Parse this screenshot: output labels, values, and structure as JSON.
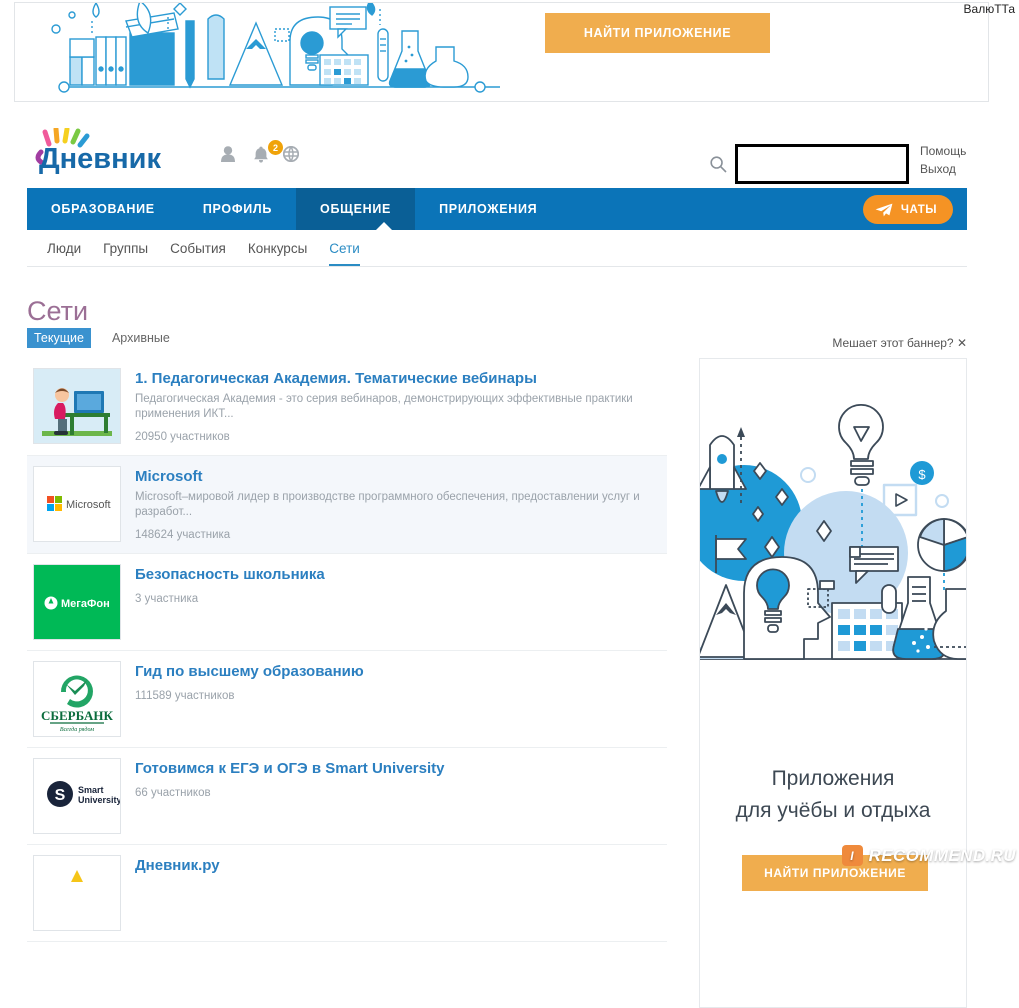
{
  "watermark_top": "ВалюТТа",
  "top_banner": {
    "cta_label": "НАЙТИ ПРИЛОЖЕНИЕ",
    "art_name": "education-illustration"
  },
  "header": {
    "logo_text": "Дневник",
    "icons": [
      {
        "name": "profile-icon",
        "label": "profile"
      },
      {
        "name": "bell-icon",
        "label": "notifications"
      },
      {
        "name": "globe-icon",
        "label": "language"
      }
    ],
    "notification_count": "2",
    "search": {
      "value": "",
      "placeholder": ""
    },
    "help_label": "Помощь",
    "logout_label": "Выход"
  },
  "nav": {
    "items": [
      {
        "label": "ОБРАЗОВАНИЕ",
        "active": false
      },
      {
        "label": "ПРОФИЛЬ",
        "active": false
      },
      {
        "label": "ОБЩЕНИЕ",
        "active": true
      },
      {
        "label": "ПРИЛОЖЕНИЯ",
        "active": false
      }
    ],
    "chat_label": "ЧАТЫ"
  },
  "subnav": {
    "items": [
      {
        "label": "Люди",
        "active": false
      },
      {
        "label": "Группы",
        "active": false
      },
      {
        "label": "События",
        "active": false
      },
      {
        "label": "Конкурсы",
        "active": false
      },
      {
        "label": "Сети",
        "active": true
      }
    ]
  },
  "page": {
    "title": "Сети",
    "filters": [
      {
        "label": "Текущие",
        "active": true
      },
      {
        "label": "Архивные",
        "active": false
      }
    ]
  },
  "networks": [
    {
      "title": "1. Педагогическая Академия. Тематические вебинары",
      "description": "Педагогическая Академия - это серия вебинаров, демонстрирующих эффективные практики применения ИКТ...",
      "members": "20950 участников",
      "logo_name": "pedagog-academy-logo",
      "highlighted": false
    },
    {
      "title": "Microsoft",
      "description": "Microsoft–мировой лидер в производстве программного обеспечения, предоставлении услуг и разработ...",
      "members": "148624 участника",
      "logo_name": "microsoft-logo",
      "highlighted": true
    },
    {
      "title": "Безопасность школьника",
      "description": "",
      "members": "3 участника",
      "logo_name": "megafon-logo",
      "highlighted": false
    },
    {
      "title": "Гид по высшему образованию",
      "description": "",
      "members": "111589 участников",
      "logo_name": "sberbank-logo",
      "highlighted": false
    },
    {
      "title": "Готовимся к ЕГЭ и ОГЭ в Smart University",
      "description": "",
      "members": "66 участников",
      "logo_name": "smart-university-logo",
      "highlighted": false
    },
    {
      "title": "Дневник.ру",
      "description": "",
      "members": "",
      "logo_name": "dnevnik-ru-logo",
      "highlighted": false
    }
  ],
  "side_banner": {
    "dismiss_label": "Мешает этот баннер?",
    "headline_line1": "Приложения",
    "headline_line2": "для учёбы и отдыха",
    "cta_label": "НАЙТИ ПРИЛОЖЕНИЕ",
    "art_name": "apps-illustration"
  },
  "recommend_watermark": "RECOMMEND.RU",
  "colors": {
    "nav_blue": "#0b74b8",
    "nav_blue_active": "#0a5f96",
    "link_blue": "#2b7fc0",
    "accent_orange": "#f0ad4e",
    "chat_orange": "#f59324",
    "title_mauve": "#9b6f95",
    "chip_blue": "#3a92cf"
  }
}
